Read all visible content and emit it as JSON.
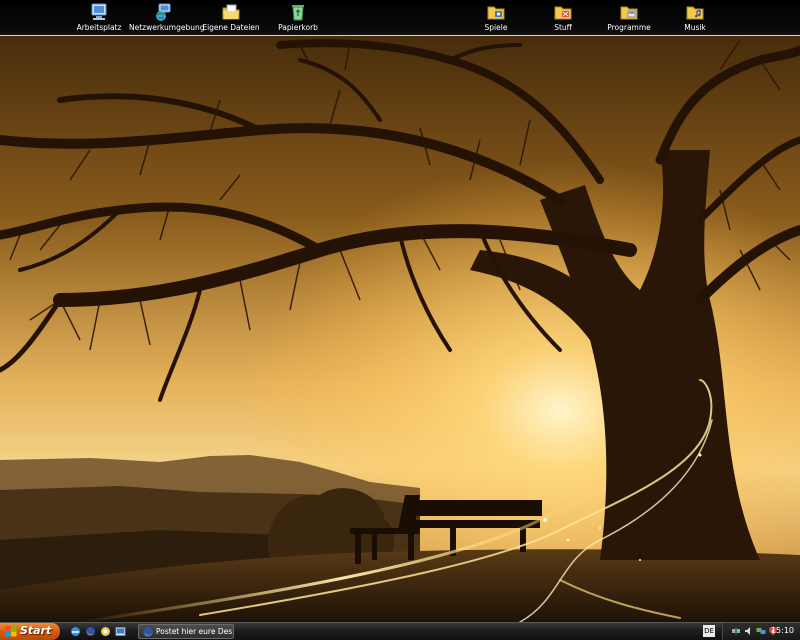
{
  "desktop": {
    "icons": [
      {
        "label": "Arbeitsplatz"
      },
      {
        "label": "Netzwerkumgebung"
      },
      {
        "label": "Eigene Dateien"
      },
      {
        "label": "Papierkorb"
      },
      {
        "label": "Spiele"
      },
      {
        "label": "Stuff"
      },
      {
        "label": "Programme"
      },
      {
        "label": "Musik"
      }
    ]
  },
  "taskbar": {
    "start_label": "Start",
    "window_title": "Postet hier eure Desk...",
    "language": "DE",
    "clock": "15:10"
  }
}
